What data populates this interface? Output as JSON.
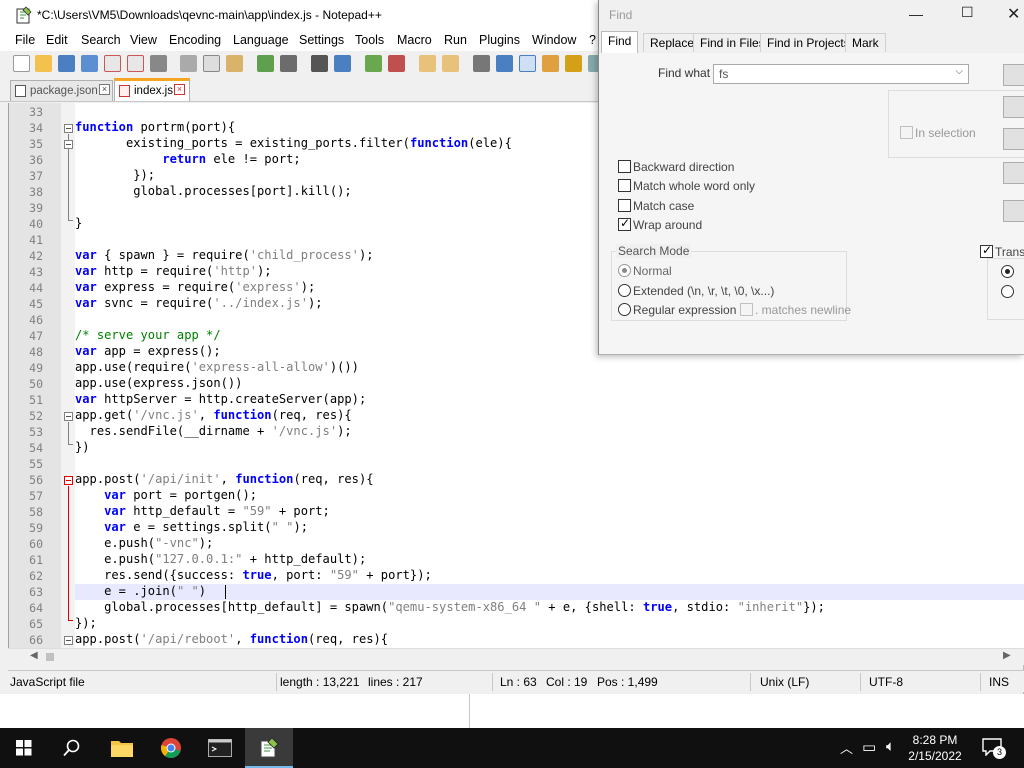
{
  "window": {
    "title": "*C:\\Users\\VM5\\Downloads\\qevnc-main\\app\\index.js - Notepad++"
  },
  "menu": [
    "File",
    "Edit",
    "Search",
    "View",
    "Encoding",
    "Language",
    "Settings",
    "Tools",
    "Macro",
    "Run",
    "Plugins",
    "Window",
    "?"
  ],
  "tabs": [
    {
      "label": "package.json",
      "active": false
    },
    {
      "label": "index.js",
      "active": true
    }
  ],
  "editor": {
    "current_line": 63,
    "lines": [
      {
        "n": "33",
        "code": ""
      },
      {
        "n": "34",
        "code": "<span class=\"kw\">function</span> portrm(port){"
      },
      {
        "n": "35",
        "code": "       existing_ports = existing_ports.filter(<span class=\"kw\">function</span>(ele){"
      },
      {
        "n": "36",
        "code": "            <span class=\"kw\">return</span> ele != port;"
      },
      {
        "n": "37",
        "code": "        });"
      },
      {
        "n": "38",
        "code": "        global.processes[port].kill();"
      },
      {
        "n": "39",
        "code": ""
      },
      {
        "n": "40",
        "code": "}"
      },
      {
        "n": "41",
        "code": ""
      },
      {
        "n": "42",
        "code": "<span class=\"kw\">var</span> { spawn } = require(<span class=\"str\">'child_process'</span>);"
      },
      {
        "n": "43",
        "code": "<span class=\"kw\">var</span> http = require(<span class=\"str\">'http'</span>);"
      },
      {
        "n": "44",
        "code": "<span class=\"kw\">var</span> express = require(<span class=\"str\">'express'</span>);"
      },
      {
        "n": "45",
        "code": "<span class=\"kw\">var</span> svnc = require(<span class=\"str\">'../index.js'</span>);"
      },
      {
        "n": "46",
        "code": ""
      },
      {
        "n": "47",
        "code": "<span class=\"cmt\">/* serve your app */</span>"
      },
      {
        "n": "48",
        "code": "<span class=\"kw\">var</span> app = express();"
      },
      {
        "n": "49",
        "code": "app.use(require(<span class=\"str\">'express-all-allow'</span>)())"
      },
      {
        "n": "50",
        "code": "app.use(express.json())"
      },
      {
        "n": "51",
        "code": "<span class=\"kw\">var</span> httpServer = http.createServer(app);"
      },
      {
        "n": "52",
        "code": "app.get(<span class=\"str\">'/vnc.js'</span>, <span class=\"kw\">function</span>(req, res){"
      },
      {
        "n": "53",
        "code": "  res.sendFile(__dirname + <span class=\"str\">'/vnc.js'</span>);"
      },
      {
        "n": "54",
        "code": "})"
      },
      {
        "n": "55",
        "code": ""
      },
      {
        "n": "56",
        "code": "app.post(<span class=\"str\">'/api/init'</span>, <span class=\"kw\">function</span>(req, res){"
      },
      {
        "n": "57",
        "code": "    <span class=\"kw\">var</span> port = portgen();"
      },
      {
        "n": "58",
        "code": "    <span class=\"kw\">var</span> http_default = <span class=\"str\">\"59\"</span> + port;"
      },
      {
        "n": "59",
        "code": "    <span class=\"kw\">var</span> e = settings.split(<span class=\"str\">\" \"</span>);"
      },
      {
        "n": "60",
        "code": "    e.push(<span class=\"str\">\"-vnc\"</span>);"
      },
      {
        "n": "61",
        "code": "    e.push(<span class=\"str\">\"127.0.0.1:\"</span> + http_default);"
      },
      {
        "n": "62",
        "code": "    res.send({success: <span class=\"kw\">true</span>, port: <span class=\"str\">\"59\"</span> + port});"
      },
      {
        "n": "63",
        "code": "    e = .join(<span class=\"str\">\" \"</span>)"
      },
      {
        "n": "64",
        "code": "    global.processes[http_default] = spawn(<span class=\"str\">\"qemu-system-x86_64 \"</span> + e, {shell: <span class=\"kw\">true</span>, stdio: <span class=\"str\">\"inherit\"</span>});"
      },
      {
        "n": "65",
        "code": "});"
      },
      {
        "n": "66",
        "code": "app.post(<span class=\"str\">'/api/reboot'</span>, <span class=\"kw\">function</span>(req, res){"
      }
    ]
  },
  "statusbar": {
    "filetype": "JavaScript file",
    "length": "length : 13,221",
    "lines": "lines : 217",
    "ln": "Ln : 63",
    "col": "Col : 19",
    "pos": "Pos : 1,499",
    "eol": "Unix (LF)",
    "encoding": "UTF-8",
    "mode": "INS"
  },
  "find_dialog": {
    "title": "Find",
    "tabs": [
      "Find",
      "Replace",
      "Find in Files",
      "Find in Projects",
      "Mark"
    ],
    "find_what_label": "Find what :",
    "find_what_value": "fs",
    "in_selection": "In selection",
    "options": [
      {
        "label": "Backward direction",
        "checked": false
      },
      {
        "label": "Match whole word only",
        "checked": false
      },
      {
        "label": "Match case",
        "checked": false
      },
      {
        "label": "Wrap around",
        "checked": true
      }
    ],
    "search_mode_label": "Search Mode",
    "modes": [
      {
        "label": "Normal",
        "checked": true
      },
      {
        "label": "Extended (\\n, \\r, \\t, \\0, \\x...)",
        "checked": false
      },
      {
        "label": "Regular expression",
        "checked": false
      }
    ],
    "matches_newline": ". matches newline",
    "transparency_label": "Transp"
  },
  "taskbar": {
    "time": "8:28 PM",
    "date": "2/15/2022",
    "notifications": "3"
  },
  "colors": {
    "keyword": "#0000ff",
    "string": "#808080",
    "comment": "#008000",
    "current_line": "#e8e8ff",
    "active_tab_accent": "#f5a623"
  }
}
